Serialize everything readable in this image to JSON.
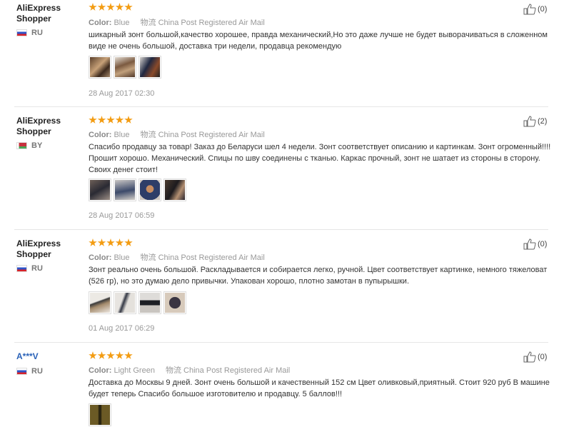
{
  "reviews": [
    {
      "user": "AliExpress Shopper",
      "country": "RU",
      "flag": "ru",
      "rating": 5,
      "color_label": "Color:",
      "color_value": "Blue",
      "shipping": "物流 China Post Registered Air Mail",
      "text": "шикарный зонт большой,качество хорошее, правда механический,Но это даже лучше не будет выворачиваться в сложенном виде не очень большой, доставка три недели, продавца рекомендую",
      "photos": 3,
      "date": "28 Aug 2017 02:30",
      "helpful": "(0)"
    },
    {
      "user": "AliExpress Shopper",
      "country": "BY",
      "flag": "by",
      "rating": 5,
      "color_label": "Color:",
      "color_value": "Blue",
      "shipping": "物流 China Post Registered Air Mail",
      "text": "Спасибо продавцу за товар! Заказ до Беларуси шел 4 недели. Зонт соответствует описанию и картинкам. Зонт огроменный!!!! Прошит хорошо. Механический. Спицы по шву соединены с тканью. Каркас прочный, зонт не шатает из стороны в сторону. Своих денег стоит!",
      "photos": 4,
      "date": "28 Aug 2017 06:59",
      "helpful": "(2)"
    },
    {
      "user": "AliExpress Shopper",
      "country": "RU",
      "flag": "ru",
      "rating": 5,
      "color_label": "Color:",
      "color_value": "Blue",
      "shipping": "物流 China Post Registered Air Mail",
      "text": "Зонт реально очень большой. Раскладывается и собирается легко, ручной. Цвет соответствует картинке, немного тяжеловат (526 гр), но это думаю дело привычки. Упакован хорошо, плотно замотан в пупырышки.",
      "photos": 4,
      "date": "01 Aug 2017 06:29",
      "helpful": "(0)"
    },
    {
      "user": "A***V",
      "country": "RU",
      "flag": "ru",
      "rating": 5,
      "color_label": "Color:",
      "color_value": "Light Green",
      "shipping": "物流 China Post Registered Air Mail",
      "text": "Доставка до Москвы 9 дней. Зонт очень большой и качественный 152 см Цвет оливковый,приятный. Стоит 920 руб В машине будет теперь Спасибо большое изготовителю и продавцу. 5 баллов!!!",
      "photos": 1,
      "date": "",
      "helpful": "(0)"
    }
  ],
  "colors": {
    "star": "#f39c12",
    "link_user": "#2a62b8"
  },
  "icons": {
    "helpful": "thumbs-up-icon",
    "rating": "star-icon"
  }
}
